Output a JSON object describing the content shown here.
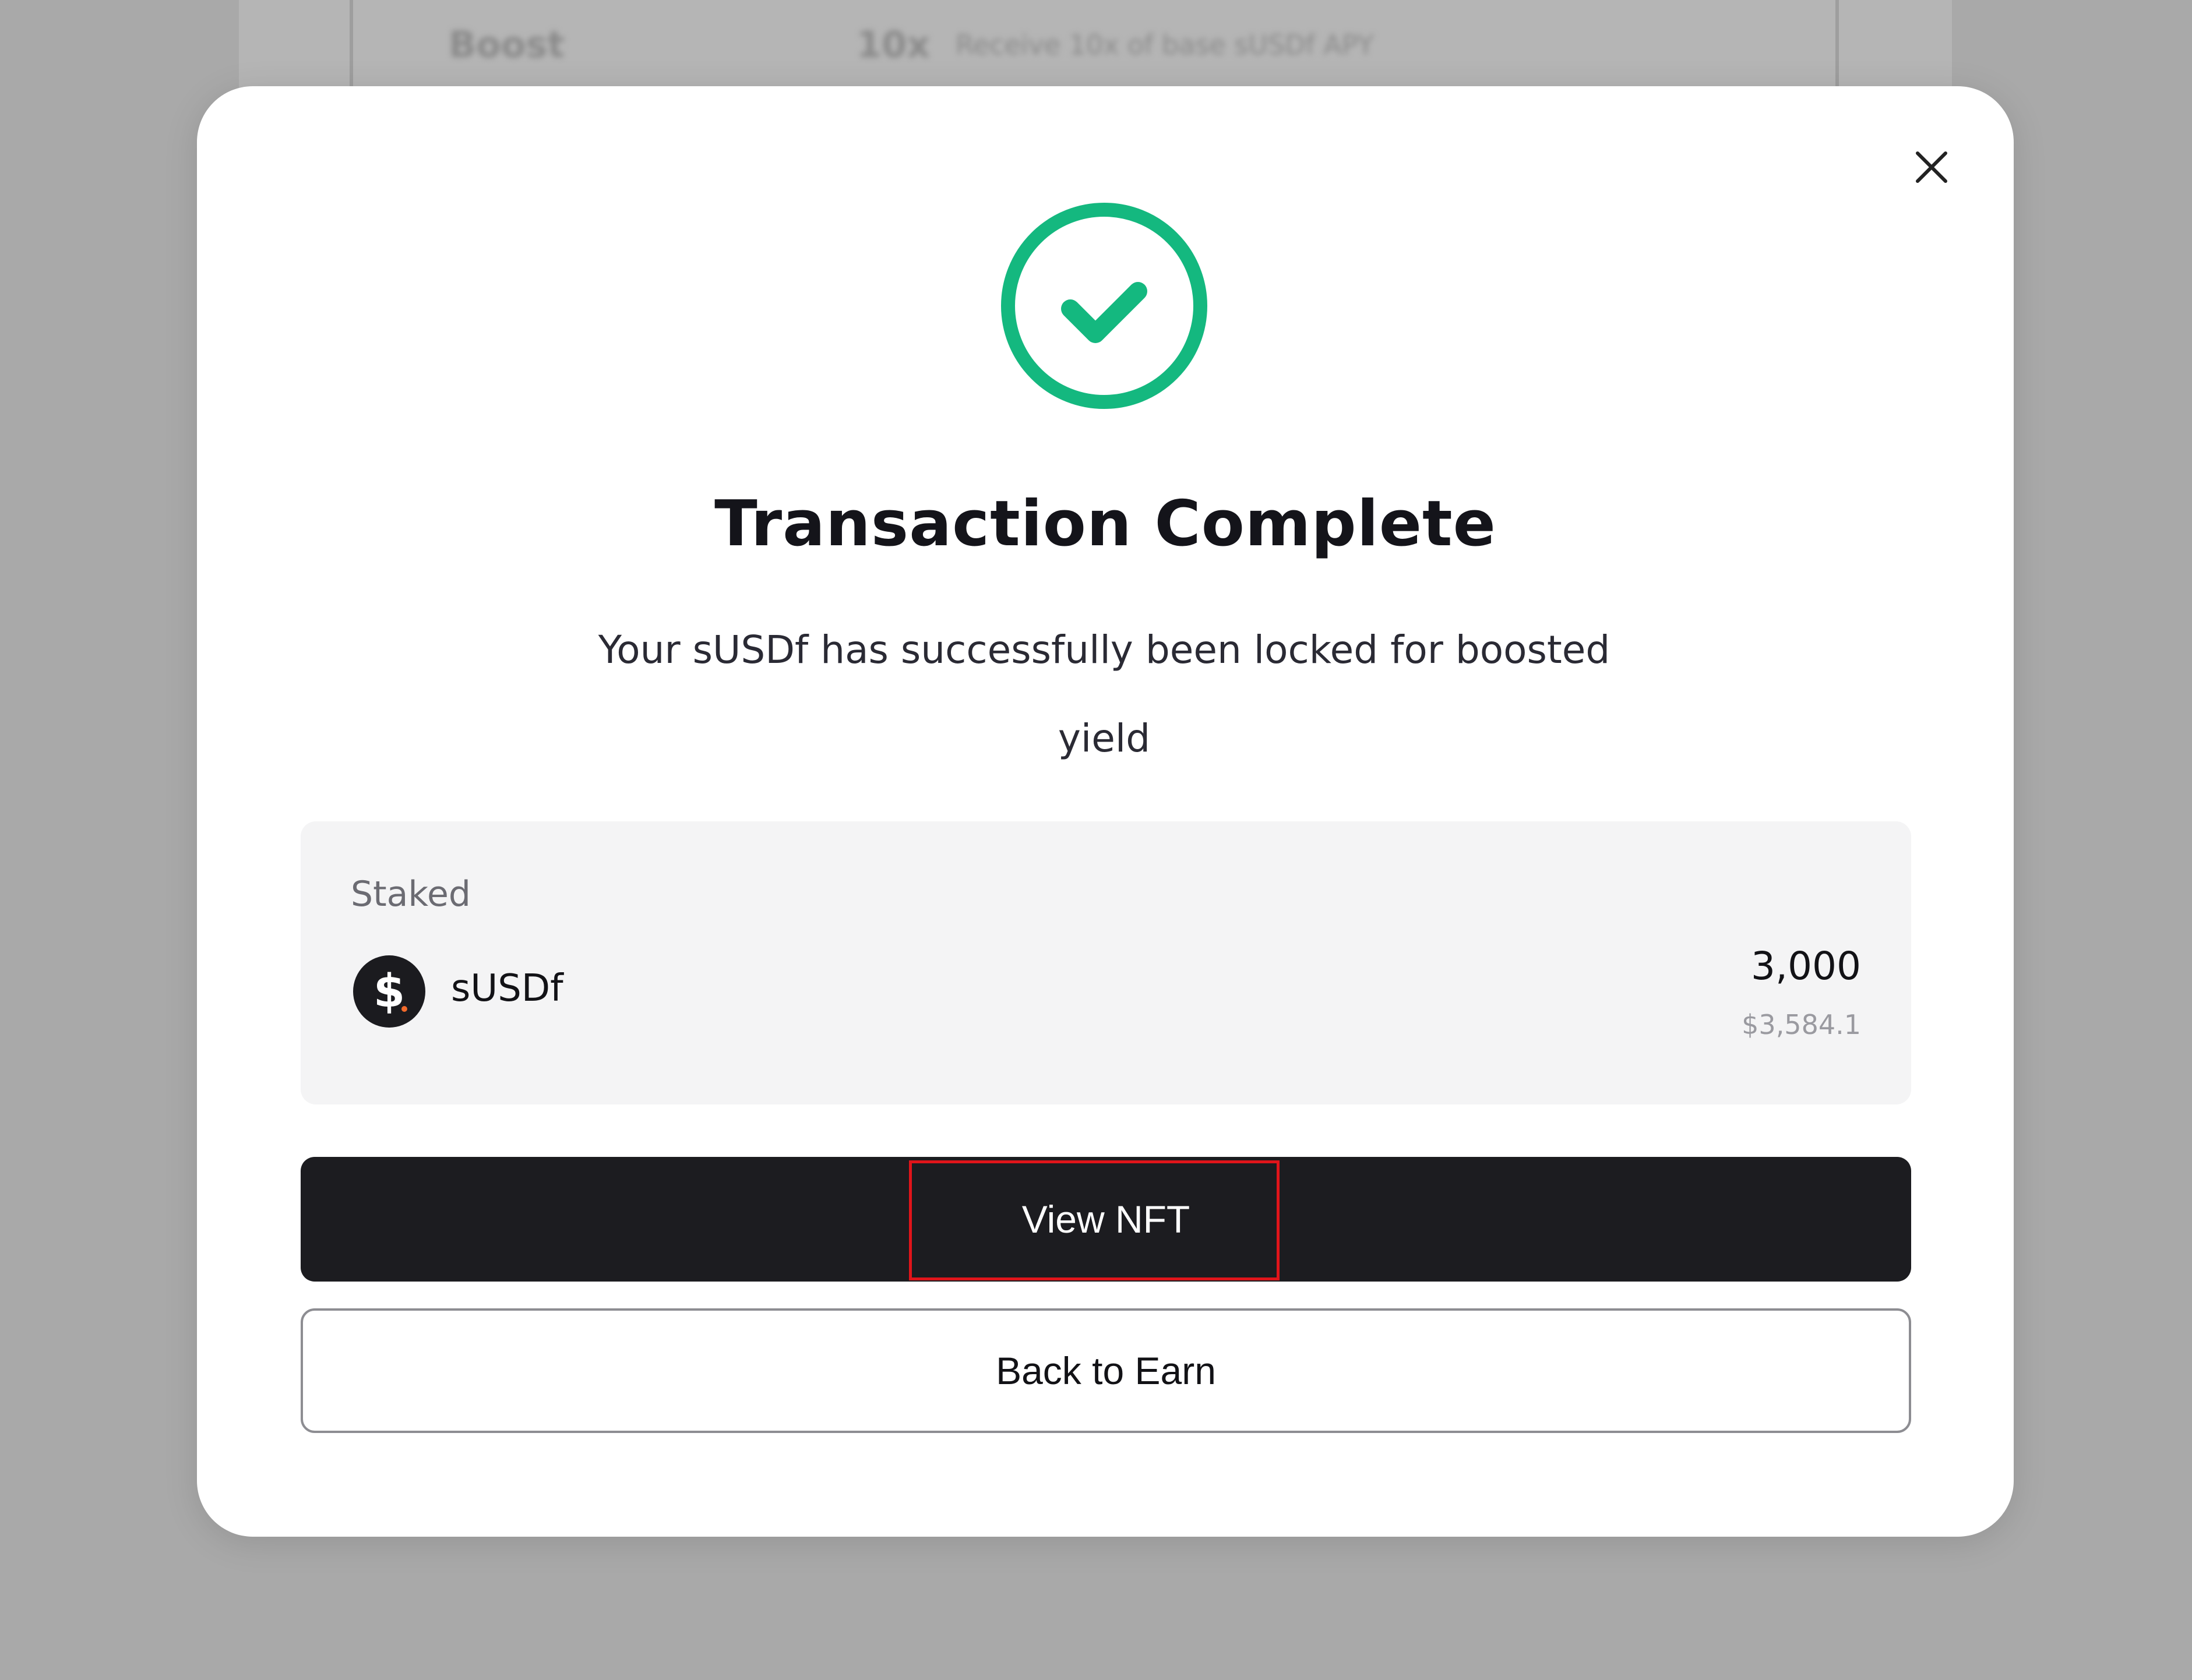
{
  "background": {
    "left_text": "Boost",
    "mid_text": "10x",
    "small_text": "Receive 10x of base sUSDf APY"
  },
  "modal": {
    "close_icon": "close-icon",
    "status_icon": "check-circle-icon",
    "title": "Transaction Complete",
    "message": "Your sUSDf has successfully been locked for boosted yield"
  },
  "staked": {
    "label": "Staked",
    "token_icon": "susdf-token-icon",
    "token_name": "sUSDf",
    "amount": "3,000",
    "amount_usd": "$3,584.1"
  },
  "actions": {
    "primary_label": "View NFT",
    "secondary_label": "Back to Earn"
  },
  "colors": {
    "success": "#14b87f",
    "primary_button": "#1c1c20",
    "highlight": "#e0141a",
    "overlay": "#a9a9a9"
  }
}
